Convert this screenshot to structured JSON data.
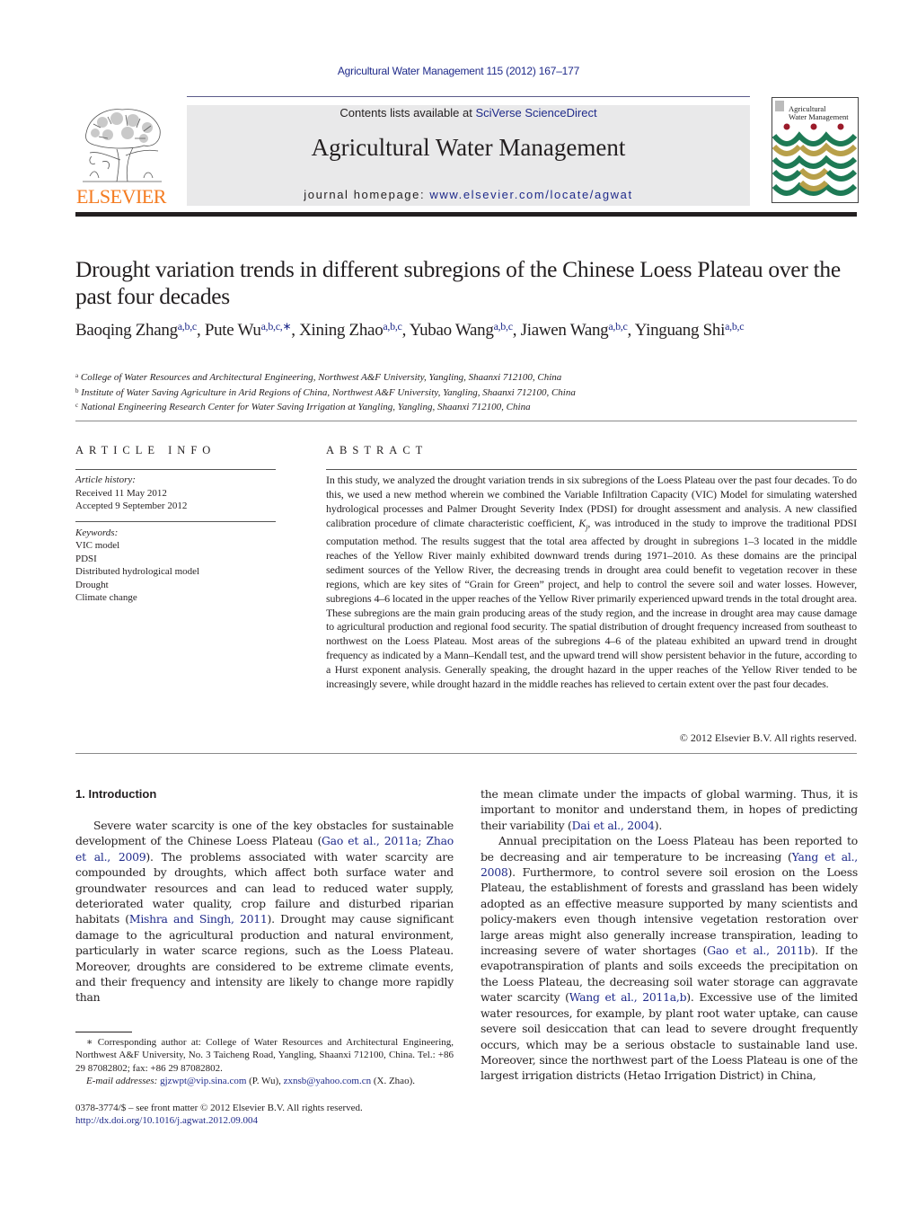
{
  "header": {
    "citation": "Agricultural Water Management 115 (2012) 167–177",
    "publisher_logo_text": "ELSEVIER",
    "contents_prefix": "Contents lists available at ",
    "contents_link": "SciVerse ScienceDirect",
    "journal_name": "Agricultural Water Management",
    "homepage_prefix": "journal homepage: ",
    "homepage_link": "www.elsevier.com/locate/agwat",
    "cover_title_line1": "Agricultural",
    "cover_title_line2": "Water Management",
    "colors": {
      "link": "#1f2a8a",
      "elsevier_orange": "#f47b20",
      "banner_bg": "#e9e9ea",
      "cover_green": "#1e7a55",
      "cover_gold": "#b8a04a",
      "cover_red": "#9b1b2a"
    }
  },
  "article": {
    "title": "Drought variation trends in different subregions of the Chinese Loess Plateau over the past four decades",
    "authors": [
      {
        "name": "Baoqing Zhang",
        "sup": "a,b,c"
      },
      {
        "name": "Pute Wu",
        "sup": "a,b,c,∗"
      },
      {
        "name": "Xining Zhao",
        "sup": "a,b,c"
      },
      {
        "name": "Yubao Wang",
        "sup": "a,b,c"
      },
      {
        "name": "Jiawen Wang",
        "sup": "a,b,c"
      },
      {
        "name": "Yinguang Shi",
        "sup": "a,b,c"
      }
    ],
    "affiliations": [
      {
        "key": "a",
        "text": "College of Water Resources and Architectural Engineering, Northwest A&F University, Yangling, Shaanxi 712100, China"
      },
      {
        "key": "b",
        "text": "Institute of Water Saving Agriculture in Arid Regions of China, Northwest A&F University, Yangling, Shaanxi 712100, China"
      },
      {
        "key": "c",
        "text": "National Engineering Research Center for Water Saving Irrigation at Yangling, Yangling, Shaanxi 712100, China"
      }
    ]
  },
  "article_info": {
    "heading": "ARTICLE INFO",
    "history_label": "Article history:",
    "received": "Received 11 May 2012",
    "accepted": "Accepted 9 September 2012",
    "keywords_label": "Keywords:",
    "keywords": [
      "VIC model",
      "PDSI",
      "Distributed hydrological model",
      "Drought",
      "Climate change"
    ]
  },
  "abstract": {
    "heading": "ABSTRACT",
    "text_part1": "In this study, we analyzed the drought variation trends in six subregions of the Loess Plateau over the past four decades. To do this, we used a new method wherein we combined the Variable Infiltration Capacity (VIC) Model for simulating watershed hydrological processes and Palmer Drought Severity Index (PDSI) for drought assessment and analysis. A new classified calibration procedure of climate characteristic coefficient, ",
    "kj": "K",
    "kj_sub": "j",
    "text_part2": ", was introduced in the study to improve the traditional PDSI computation method. The results suggest that the total area affected by drought in subregions 1–3 located in the middle reaches of the Yellow River mainly exhibited downward trends during 1971–2010. As these domains are the principal sediment sources of the Yellow River, the decreasing trends in drought area could benefit to vegetation recover in these regions, which are key sites of “Grain for Green” project, and help to control the severe soil and water losses. However, subregions 4–6 located in the upper reaches of the Yellow River primarily experienced upward trends in the total drought area. These subregions are the main grain producing areas of the study region, and the increase in drought area may cause damage to agricultural production and regional food security. The spatial distribution of drought frequency increased from southeast to northwest on the Loess Plateau. Most areas of the subregions 4–6 of the plateau exhibited an upward trend in drought frequency as indicated by a Mann–Kendall test, and the upward trend will show persistent behavior in the future, according to a Hurst exponent analysis. Generally speaking, the drought hazard in the upper reaches of the Yellow River tended to be increasingly severe, while drought hazard in the middle reaches has relieved to certain extent over the past four decades.",
    "copyright": "© 2012 Elsevier B.V. All rights reserved."
  },
  "introduction": {
    "heading": "1.  Introduction",
    "p1": [
      {
        "t": "Severe water scarcity is one of the key obstacles for sustainable development of the Chinese Loess Plateau ("
      },
      {
        "link": "Gao et al., 2011a; Zhao et al., 2009"
      },
      {
        "t": "). The problems associated with water scarcity are compounded by droughts, which affect both surface water and groundwater resources and can lead to reduced water supply, deteriorated water quality, crop failure and disturbed riparian habitats ("
      },
      {
        "link": "Mishra and Singh, 2011"
      },
      {
        "t": "). Drought may cause significant damage to the agricultural production and natural environment, particularly in water scarce regions, such as the Loess Plateau. Moreover, droughts are considered to be extreme climate events, and their frequency and intensity are likely to change more rapidly than"
      }
    ],
    "p1_cont": [
      {
        "t": "the mean climate under the impacts of global warming. Thus, it is important to monitor and understand them, in hopes of predicting their variability ("
      },
      {
        "link": "Dai et al., 2004"
      },
      {
        "t": ")."
      }
    ],
    "p2": [
      {
        "t": "Annual precipitation on the Loess Plateau has been reported to be decreasing and air temperature to be increasing ("
      },
      {
        "link": "Yang et al., 2008"
      },
      {
        "t": "). Furthermore, to control severe soil erosion on the Loess Plateau, the establishment of forests and grassland has been widely adopted as an effective measure supported by many scientists and policy-makers even though intensive vegetation restoration over large areas might also generally increase transpiration, leading to increasing severe of water shortages ("
      },
      {
        "link": "Gao et al., 2011b"
      },
      {
        "t": "). If the evapotranspiration of plants and soils exceeds the precipitation on the Loess Plateau, the decreasing soil water storage can aggravate water scarcity ("
      },
      {
        "link": "Wang et al., 2011a,b"
      },
      {
        "t": "). Excessive use of the limited water resources, for example, by plant root water uptake, can cause severe soil desiccation that can lead to severe drought frequently occurs, which may be a serious obstacle to sustainable land use. Moreover, since the northwest part of the Loess Plateau is one of the largest irrigation districts (Hetao Irrigation District) in China,"
      }
    ]
  },
  "footnote": {
    "corresponding": "∗ Corresponding author at: College of Water Resources and Architectural Engineering, Northwest A&F University, No. 3 Taicheng Road, Yangling, Shaanxi 712100, China. Tel.: +86 29 87082802; fax: +86 29 87082802.",
    "email_label": "E-mail addresses:",
    "email1": "gjzwpt@vip.sina.com",
    "email1_who": " (P. Wu), ",
    "email2": "zxnsb@yahoo.com.cn",
    "email2_who": " (X. Zhao)."
  },
  "front_matter": {
    "issn_line": "0378-3774/$ – see front matter © 2012 Elsevier B.V. All rights reserved.",
    "doi": "http://dx.doi.org/10.1016/j.agwat.2012.09.004"
  }
}
